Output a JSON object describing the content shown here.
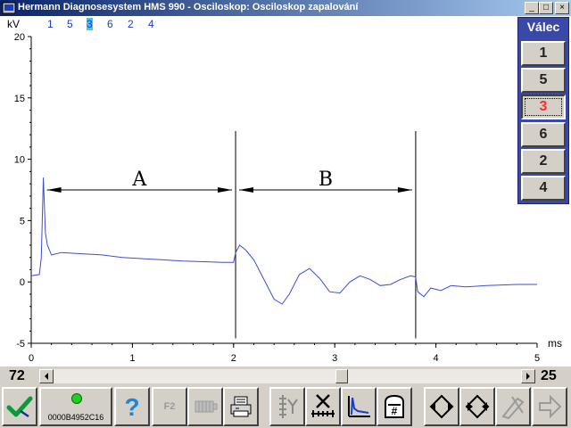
{
  "window": {
    "title": "Hermann Diagnosesystem HMS 990 - Osciloskop: Osciloskop zapalování",
    "controls": {
      "minimize": "_",
      "maximize": "□",
      "close": "×"
    }
  },
  "scope": {
    "y_unit": "kV",
    "x_unit": "ms",
    "firing_order": [
      "1",
      "5",
      "3",
      "6",
      "2",
      "4"
    ],
    "selected_in_order": "3",
    "segment_labels": {
      "a": "A",
      "b": "B"
    }
  },
  "chart_data": {
    "type": "line",
    "xlabel": "ms",
    "ylabel": "kV",
    "xlim": [
      0,
      5
    ],
    "ylim": [
      -5,
      20
    ],
    "x_ticks": [
      "0",
      "1",
      "2",
      "3",
      "4",
      "5"
    ],
    "y_ticks": [
      "-5",
      "0",
      "5",
      "10",
      "15",
      "20"
    ],
    "grid": false,
    "series": [
      {
        "color": "#3a4fd6",
        "points": [
          [
            0.0,
            0.5
          ],
          [
            0.08,
            0.6
          ],
          [
            0.1,
            2.0
          ],
          [
            0.12,
            8.5
          ],
          [
            0.14,
            4.0
          ],
          [
            0.16,
            3.0
          ],
          [
            0.2,
            2.2
          ],
          [
            0.3,
            2.4
          ],
          [
            0.5,
            2.3
          ],
          [
            0.7,
            2.2
          ],
          [
            0.9,
            2.0
          ],
          [
            1.1,
            1.9
          ],
          [
            1.3,
            1.8
          ],
          [
            1.5,
            1.7
          ],
          [
            1.7,
            1.65
          ],
          [
            1.9,
            1.6
          ],
          [
            2.0,
            1.6
          ],
          [
            2.02,
            2.4
          ],
          [
            2.06,
            3.0
          ],
          [
            2.12,
            2.6
          ],
          [
            2.2,
            1.8
          ],
          [
            2.3,
            0.2
          ],
          [
            2.4,
            -1.4
          ],
          [
            2.48,
            -1.8
          ],
          [
            2.55,
            -1.0
          ],
          [
            2.65,
            0.6
          ],
          [
            2.75,
            1.1
          ],
          [
            2.85,
            0.3
          ],
          [
            2.95,
            -0.8
          ],
          [
            3.05,
            -0.9
          ],
          [
            3.15,
            0.0
          ],
          [
            3.25,
            0.5
          ],
          [
            3.35,
            0.2
          ],
          [
            3.45,
            -0.3
          ],
          [
            3.55,
            -0.2
          ],
          [
            3.65,
            0.2
          ],
          [
            3.75,
            0.5
          ],
          [
            3.8,
            0.4
          ],
          [
            3.82,
            -0.8
          ],
          [
            3.88,
            -1.2
          ],
          [
            3.95,
            -0.5
          ],
          [
            4.05,
            -0.7
          ],
          [
            4.15,
            -0.3
          ],
          [
            4.3,
            -0.4
          ],
          [
            4.5,
            -0.3
          ],
          [
            4.8,
            -0.2
          ],
          [
            5.0,
            -0.2
          ]
        ]
      }
    ],
    "annotations": [
      {
        "label": "A",
        "x_from": 0.12,
        "x_to": 2.02,
        "y": 7.5
      },
      {
        "label": "B",
        "x_from": 2.02,
        "x_to": 3.8,
        "y": 7.5
      }
    ],
    "vertical_markers": [
      2.02,
      3.8
    ]
  },
  "cylinder_panel": {
    "title": "Válec",
    "buttons": [
      "1",
      "5",
      "3",
      "6",
      "2",
      "4"
    ],
    "active": "3"
  },
  "scroll_row": {
    "left_value": "72",
    "right_value": "25",
    "thumb_position": 0.62
  },
  "toolbar": {
    "status_id": "0000B4952C16",
    "f2_label": "F2"
  },
  "colors": {
    "trace": "#3a4fd6",
    "panel": "#3a48a8",
    "active_cylinder": "#ff2a2a",
    "status_led": "#22cc22"
  }
}
